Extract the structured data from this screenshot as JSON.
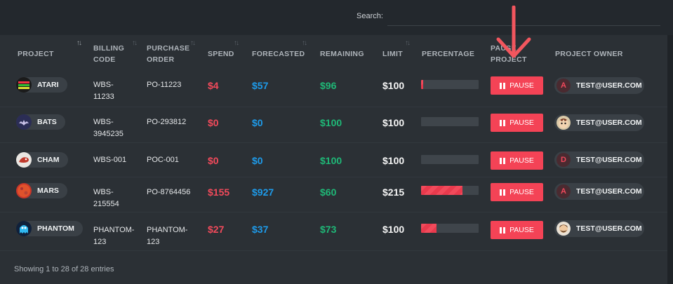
{
  "search": {
    "label": "Search:",
    "value": ""
  },
  "headers": [
    {
      "key": "project",
      "label": "PROJECT",
      "left": 0
    },
    {
      "key": "billing",
      "label": "BILLING\nCODE"
    },
    {
      "key": "po",
      "label": "PURCHASE\nORDER"
    },
    {
      "key": "spend",
      "label": "SPEND"
    },
    {
      "key": "forecasted",
      "label": "FORECASTED"
    },
    {
      "key": "remaining",
      "label": "REMAINING"
    },
    {
      "key": "limit",
      "label": "LIMIT"
    },
    {
      "key": "percentage",
      "label": "PERCENTAGE"
    },
    {
      "key": "pause",
      "label": "PAUSE\nPROJECT"
    },
    {
      "key": "owner",
      "label": "PROJECT OWNER"
    }
  ],
  "rows": [
    {
      "project": "ATARI",
      "project_icon": "atari-game-icon",
      "billing": "WBS-\n11233",
      "po": "PO-11223",
      "spend": "$4",
      "forecasted": "$57",
      "remaining": "$96",
      "limit": "$100",
      "percent": 4,
      "pause_label": "PAUSE",
      "owner": "TEST@USER.COM",
      "owner_avatar": "A"
    },
    {
      "project": "BATS",
      "project_icon": "bat-icon",
      "billing": "WBS-\n3945235",
      "po": "PO-293812",
      "spend": "$0",
      "forecasted": "$0",
      "remaining": "$100",
      "limit": "$100",
      "percent": 0,
      "pause_label": "PAUSE",
      "owner": "TEST@USER.COM",
      "owner_avatar": "cartoon-face-avatar"
    },
    {
      "project": "CHAM",
      "project_icon": "chameleon-icon",
      "billing": "WBS-001",
      "po": "POC-001",
      "spend": "$0",
      "forecasted": "$0",
      "remaining": "$100",
      "limit": "$100",
      "percent": 0,
      "pause_label": "PAUSE",
      "owner": "TEST@USER.COM",
      "owner_avatar": "D"
    },
    {
      "project": "MARS",
      "project_icon": "mars-planet-icon",
      "billing": "WBS-\n215554",
      "po": "PO-8764456",
      "spend": "$155",
      "forecasted": "$927",
      "remaining": "$60",
      "limit": "$215",
      "percent": 72,
      "pause_label": "PAUSE",
      "owner": "TEST@USER.COM",
      "owner_avatar": "A"
    },
    {
      "project": "PHANTOM",
      "project_icon": "ghost-icon",
      "billing": "PHANTOM-\n123",
      "po": "PHANTOM-\n123",
      "spend": "$27",
      "forecasted": "$37",
      "remaining": "$73",
      "limit": "$100",
      "percent": 27,
      "pause_label": "PAUSE",
      "owner": "TEST@USER.COM",
      "owner_avatar": "bearded-man-avatar"
    }
  ],
  "footer": "Showing 1 to 28 of 28 entries",
  "colors": {
    "spend": "#f24a5b",
    "forecasted": "#1e9bea",
    "remaining": "#1fb877",
    "accent": "#f44356"
  }
}
